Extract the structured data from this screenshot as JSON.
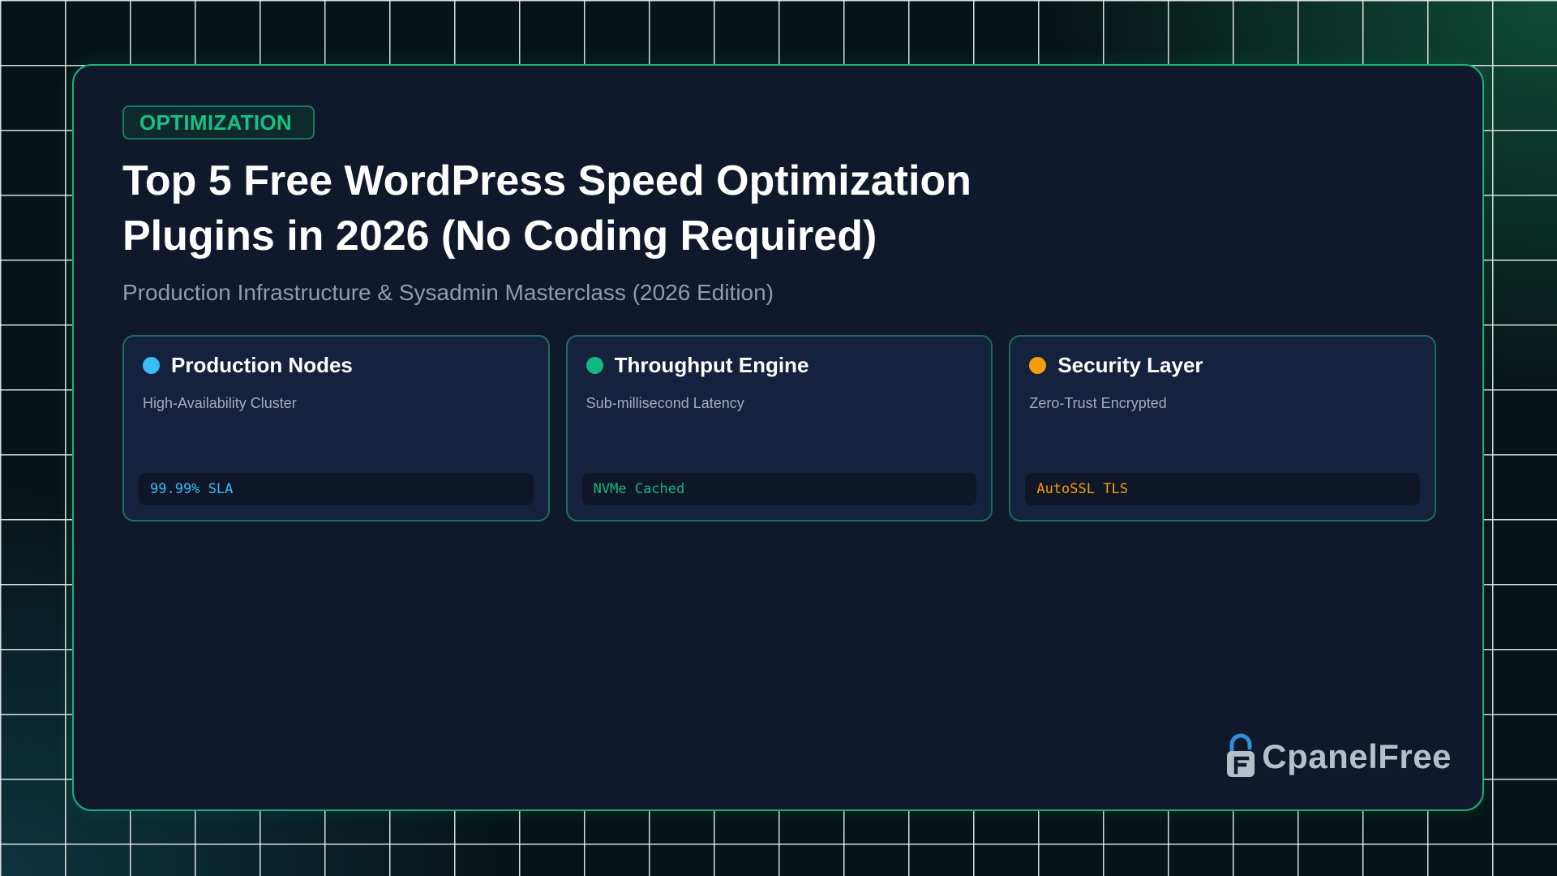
{
  "badge": "OPTIMIZATION",
  "title": "Top 5 Free WordPress Speed Optimization Plugins in 2026 (No Coding Required)",
  "subtitle": "Production Infrastructure & Sysadmin Masterclass (2026 Edition)",
  "features": [
    {
      "title": "Production Nodes",
      "description": "High-Availability Cluster",
      "tag": "99.99% SLA",
      "color": "#38bdf8"
    },
    {
      "title": "Throughput Engine",
      "description": "Sub-millisecond Latency",
      "tag": "NVMe Cached",
      "color": "#10b981"
    },
    {
      "title": "Security Layer",
      "description": "Zero-Trust Encrypted",
      "tag": "AutoSSL TLS",
      "color": "#f59e0b"
    }
  ],
  "brand": {
    "name": "CpanelFree",
    "icon": "padlock-logo-icon"
  },
  "colors": {
    "accent": "#10b981",
    "card_background": "#10192c",
    "page_background": "#071417"
  }
}
